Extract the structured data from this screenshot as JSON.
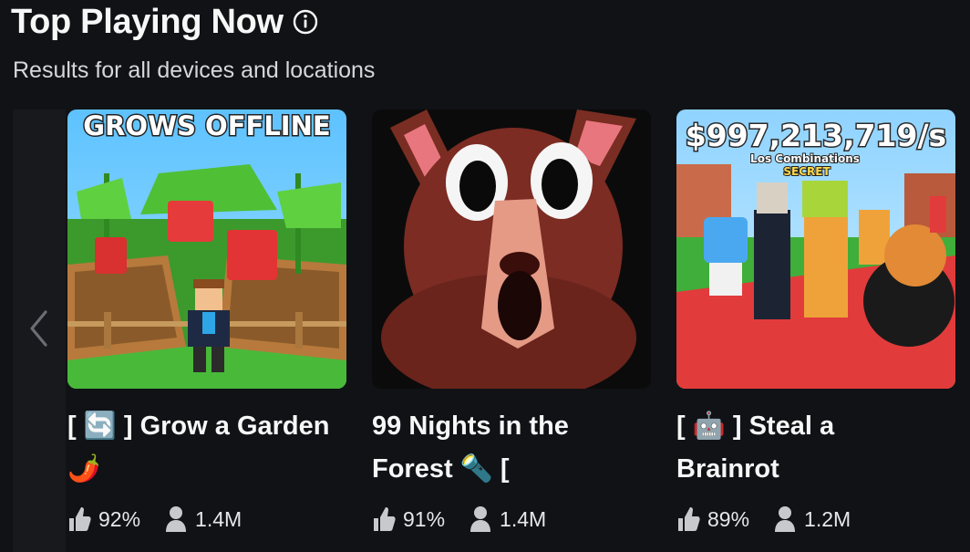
{
  "header": {
    "title": "Top Playing Now",
    "subtitle": "Results for all devices and locations"
  },
  "games": [
    {
      "name_line1": "[ 🔄 ] Grow a Garden",
      "name_line2": "🌶️",
      "thumb_caption": "GROWS OFFLINE",
      "rating": "92%",
      "players": "1.4M"
    },
    {
      "name_line1": "99 Nights in the",
      "name_line2": "Forest 🔦 [",
      "thumb_caption": "",
      "rating": "91%",
      "players": "1.4M"
    },
    {
      "name_line1": "[ 🤖 ] Steal a",
      "name_line2": "Brainrot",
      "thumb_caption": "$997,213,719/s",
      "thumb_sub1": "Los Combinations",
      "thumb_sub2": "SECRET",
      "rating": "89%",
      "players": "1.2M"
    }
  ],
  "colors": {
    "background": "#111216",
    "text": "#f7f7f8"
  }
}
